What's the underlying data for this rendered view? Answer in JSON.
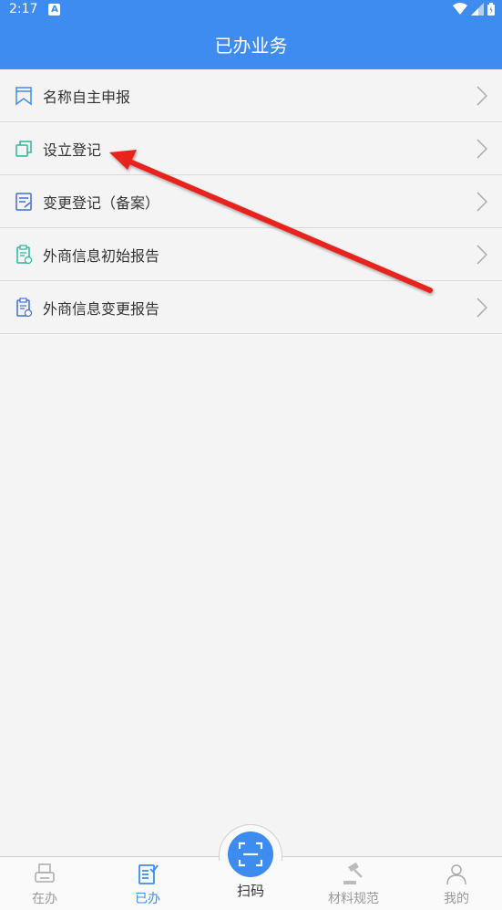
{
  "status_bar": {
    "time": "2:17",
    "notification_icon": "A"
  },
  "header": {
    "title": "已办业务"
  },
  "list": {
    "items": [
      {
        "label": "名称自主申报",
        "icon": "bookmark-icon"
      },
      {
        "label": "设立登记",
        "icon": "copy-icon"
      },
      {
        "label": "变更登记（备案）",
        "icon": "edit-document-icon"
      },
      {
        "label": "外商信息初始报告",
        "icon": "clipboard-add-icon"
      },
      {
        "label": "外商信息变更报告",
        "icon": "clipboard-edit-icon"
      }
    ]
  },
  "tabbar": {
    "tabs": [
      {
        "label": "在办",
        "icon": "printer-icon"
      },
      {
        "label": "已办",
        "icon": "checklist-icon",
        "active": true
      },
      {
        "label": "扫码",
        "icon": "scan-icon"
      },
      {
        "label": "材料规范",
        "icon": "gavel-icon"
      },
      {
        "label": "我的",
        "icon": "user-icon"
      }
    ]
  },
  "colors": {
    "primary": "#3f8cf1",
    "annotation_arrow": "#e8201a",
    "icon_green": "#2bb59a"
  }
}
